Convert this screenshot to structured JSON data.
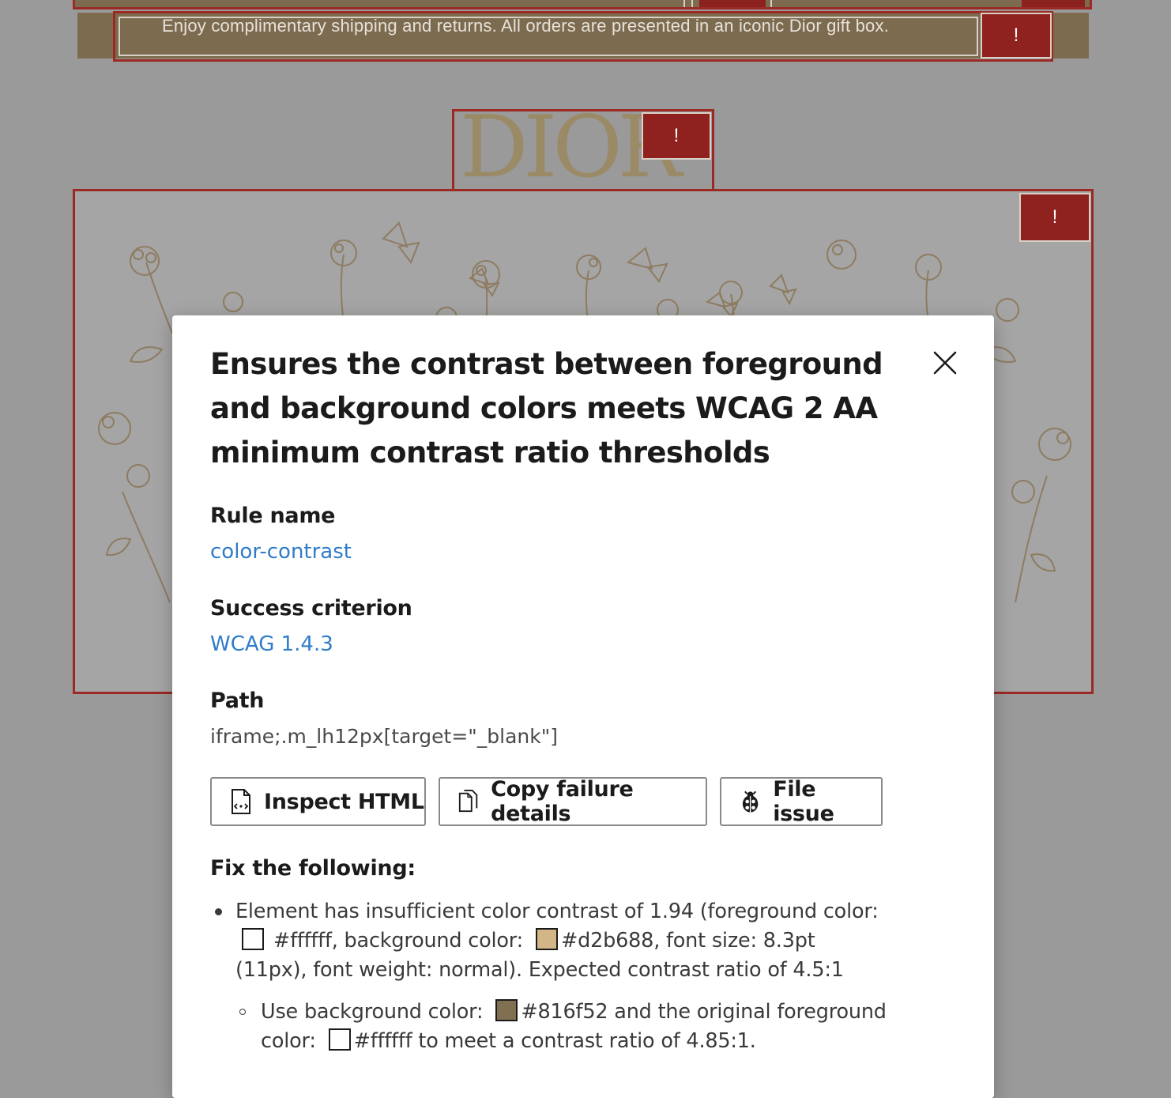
{
  "background_page": {
    "banner_text": "Enjoy complimentary shipping and returns. All orders are presented in an iconic Dior gift box.",
    "logo_text": "DIOR",
    "alert_glyph": "!"
  },
  "dialog": {
    "title": "Ensures the contrast between foreground and background colors meets WCAG 2 AA minimum contrast ratio thresholds",
    "close_icon": "close-icon",
    "rule_name_label": "Rule name",
    "rule_name_value": "color-contrast",
    "success_criterion_label": "Success criterion",
    "success_criterion_value": "WCAG 1.4.3",
    "path_label": "Path",
    "path_value": "iframe;.m_lh12px[target=\"_blank\"]",
    "buttons": {
      "inspect_html": "Inspect HTML",
      "copy_failure": "Copy failure details",
      "file_issue": "File issue"
    },
    "fix_label": "Fix the following:",
    "fix_item": {
      "part1": "Element has insufficient color contrast of 1.94 (foreground color:",
      "fg_color": "#ffffff",
      "part2": ", background color:",
      "bg_color": "#d2b688",
      "part3": ", font size: 8.3pt (11px), font weight: normal). Expected contrast ratio of 4.5:1"
    },
    "fix_sub_item": {
      "part1": "Use background color:",
      "suggested_bg": "#816f52",
      "part2": "and the original foreground color:",
      "fg_color": "#ffffff",
      "part3": "to meet a contrast ratio of 4.85:1."
    }
  },
  "colors": {
    "overlay": "#9a9a9a",
    "failure_outline": "#9b2a25",
    "link": "#2f7cc9",
    "swatch_fg": "#ffffff",
    "swatch_bg": "#d2b688",
    "swatch_suggested": "#816f52"
  }
}
